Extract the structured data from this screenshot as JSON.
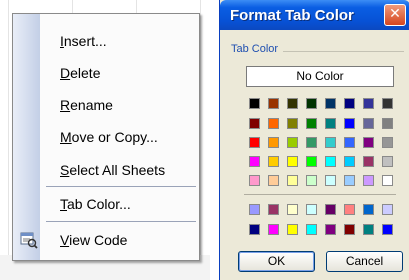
{
  "context_menu": {
    "items": [
      {
        "pre": "",
        "ul": "I",
        "post": "nsert..."
      },
      {
        "pre": "",
        "ul": "D",
        "post": "elete"
      },
      {
        "pre": "",
        "ul": "R",
        "post": "ename"
      },
      {
        "pre": "",
        "ul": "M",
        "post": "ove or Copy..."
      },
      {
        "pre": "",
        "ul": "S",
        "post": "elect All Sheets"
      },
      {
        "pre": "",
        "ul": "T",
        "post": "ab Color..."
      },
      {
        "pre": "",
        "ul": "V",
        "post": "iew Code",
        "icon": "view-code-icon"
      }
    ]
  },
  "dialog": {
    "title": "Format Tab Color",
    "close_glyph": "✕",
    "group_label": "Tab Color",
    "no_color_label": "No Color",
    "ok_label": "OK",
    "cancel_label": "Cancel",
    "palette_main": [
      [
        "#000000",
        "#993300",
        "#333300",
        "#003300",
        "#003366",
        "#000080",
        "#333399",
        "#333333"
      ],
      [
        "#800000",
        "#ff6600",
        "#808000",
        "#008000",
        "#008080",
        "#0000ff",
        "#666699",
        "#808080"
      ],
      [
        "#ff0000",
        "#ff9900",
        "#99cc00",
        "#339966",
        "#33cccc",
        "#3366ff",
        "#800080",
        "#969696"
      ],
      [
        "#ff00ff",
        "#ffcc00",
        "#ffff00",
        "#00ff00",
        "#00ffff",
        "#00ccff",
        "#993366",
        "#c0c0c0"
      ],
      [
        "#ff99cc",
        "#ffcc99",
        "#ffff99",
        "#ccffcc",
        "#ccffff",
        "#99ccff",
        "#cc99ff",
        "#ffffff"
      ]
    ],
    "palette_extra": [
      [
        "#9999ff",
        "#993366",
        "#ffffcc",
        "#ccffff",
        "#660066",
        "#ff8080",
        "#0066cc",
        "#ccccff"
      ],
      [
        "#000080",
        "#ff00ff",
        "#ffff00",
        "#00ffff",
        "#800080",
        "#800000",
        "#008080",
        "#0000ff"
      ]
    ]
  }
}
